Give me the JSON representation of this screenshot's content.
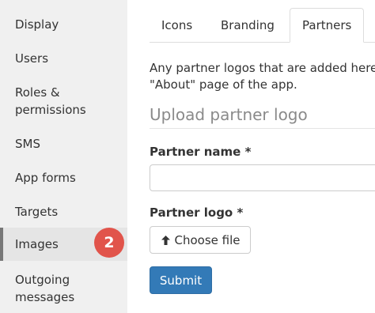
{
  "sidebar": {
    "items": [
      {
        "label": "Display"
      },
      {
        "label": "Users"
      },
      {
        "label": "Roles &"
      },
      {
        "label": "permissions"
      },
      {
        "label": "SMS"
      },
      {
        "label": "App forms"
      },
      {
        "label": "Targets"
      },
      {
        "label": "Images"
      },
      {
        "label": "Outgoing"
      },
      {
        "label": "messages"
      }
    ],
    "active": "Images",
    "badge": "2"
  },
  "tabs": [
    {
      "label": "Icons"
    },
    {
      "label": "Branding"
    },
    {
      "label": "Partners"
    }
  ],
  "active_tab": "Partners",
  "main": {
    "intro_line1": "Any partner logos that are added here",
    "intro_line2": "\"About\" page of the app.",
    "upload_heading": "Upload partner logo",
    "partner_name_label": "Partner name *",
    "partner_name_value": "",
    "partner_logo_label": "Partner logo *",
    "choose_file_label": "Choose file",
    "submit_label": "Submit"
  },
  "colors": {
    "badge": "#e1544b",
    "primary_button": "#337ab7",
    "sidebar_bg": "#f0f0f0"
  }
}
